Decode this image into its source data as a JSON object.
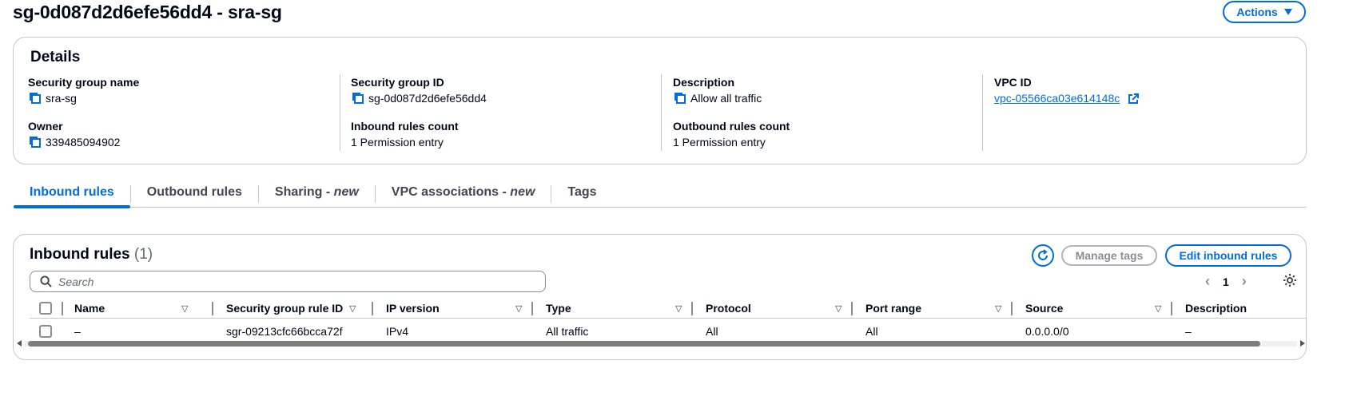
{
  "page": {
    "title": "sg-0d087d2d6efe56dd4 - sra-sg",
    "actions_label": "Actions"
  },
  "details": {
    "heading": "Details",
    "security_group_name": {
      "label": "Security group name",
      "value": "sra-sg"
    },
    "security_group_id": {
      "label": "Security group ID",
      "value": "sg-0d087d2d6efe56dd4"
    },
    "description": {
      "label": "Description",
      "value": "Allow all traffic"
    },
    "vpc_id": {
      "label": "VPC ID",
      "value": "vpc-05566ca03e614148c"
    },
    "owner": {
      "label": "Owner",
      "value": "339485094902"
    },
    "inbound_rules_count": {
      "label": "Inbound rules count",
      "value": "1 Permission entry"
    },
    "outbound_rules_count": {
      "label": "Outbound rules count",
      "value": "1 Permission entry"
    }
  },
  "tabs": [
    {
      "label": "Inbound rules",
      "suffix": "",
      "active": true
    },
    {
      "label": "Outbound rules",
      "suffix": "",
      "active": false
    },
    {
      "label": "Sharing - ",
      "suffix": "new",
      "active": false
    },
    {
      "label": "VPC associations - ",
      "suffix": "new",
      "active": false
    },
    {
      "label": "Tags",
      "suffix": "",
      "active": false
    }
  ],
  "inbound": {
    "heading": "Inbound rules",
    "count": "(1)",
    "manage_tags_label": "Manage tags",
    "edit_label": "Edit inbound rules",
    "search_placeholder": "Search",
    "current_page": "1",
    "columns": [
      "Name",
      "Security group rule ID",
      "IP version",
      "Type",
      "Protocol",
      "Port range",
      "Source",
      "Description"
    ],
    "rows": [
      [
        "–",
        "sgr-09213cfc66bcca72f",
        "IPv4",
        "All traffic",
        "All",
        "All",
        "0.0.0.0/0",
        "–"
      ]
    ]
  },
  "colors": {
    "accent": "#006ce0",
    "border": "#c6c6cd",
    "text": "#000716"
  }
}
